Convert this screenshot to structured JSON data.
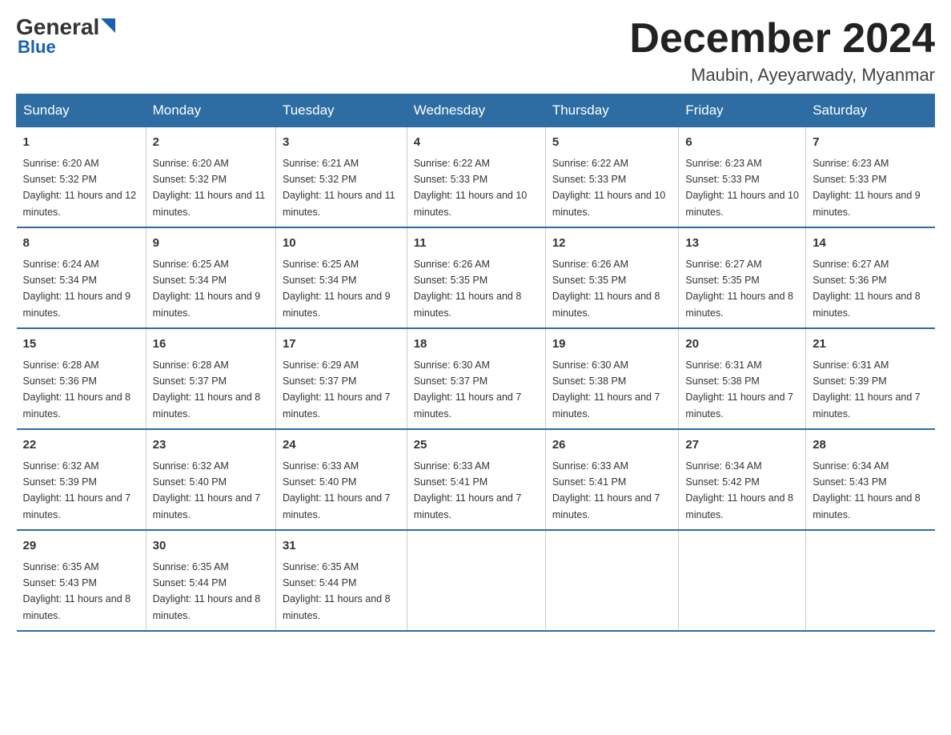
{
  "logo": {
    "general": "General",
    "blue": "Blue"
  },
  "header": {
    "month_title": "December 2024",
    "location": "Maubin, Ayeyarwady, Myanmar"
  },
  "days_of_week": [
    "Sunday",
    "Monday",
    "Tuesday",
    "Wednesday",
    "Thursday",
    "Friday",
    "Saturday"
  ],
  "weeks": [
    [
      {
        "day": "1",
        "sunrise": "Sunrise: 6:20 AM",
        "sunset": "Sunset: 5:32 PM",
        "daylight": "Daylight: 11 hours and 12 minutes."
      },
      {
        "day": "2",
        "sunrise": "Sunrise: 6:20 AM",
        "sunset": "Sunset: 5:32 PM",
        "daylight": "Daylight: 11 hours and 11 minutes."
      },
      {
        "day": "3",
        "sunrise": "Sunrise: 6:21 AM",
        "sunset": "Sunset: 5:32 PM",
        "daylight": "Daylight: 11 hours and 11 minutes."
      },
      {
        "day": "4",
        "sunrise": "Sunrise: 6:22 AM",
        "sunset": "Sunset: 5:33 PM",
        "daylight": "Daylight: 11 hours and 10 minutes."
      },
      {
        "day": "5",
        "sunrise": "Sunrise: 6:22 AM",
        "sunset": "Sunset: 5:33 PM",
        "daylight": "Daylight: 11 hours and 10 minutes."
      },
      {
        "day": "6",
        "sunrise": "Sunrise: 6:23 AM",
        "sunset": "Sunset: 5:33 PM",
        "daylight": "Daylight: 11 hours and 10 minutes."
      },
      {
        "day": "7",
        "sunrise": "Sunrise: 6:23 AM",
        "sunset": "Sunset: 5:33 PM",
        "daylight": "Daylight: 11 hours and 9 minutes."
      }
    ],
    [
      {
        "day": "8",
        "sunrise": "Sunrise: 6:24 AM",
        "sunset": "Sunset: 5:34 PM",
        "daylight": "Daylight: 11 hours and 9 minutes."
      },
      {
        "day": "9",
        "sunrise": "Sunrise: 6:25 AM",
        "sunset": "Sunset: 5:34 PM",
        "daylight": "Daylight: 11 hours and 9 minutes."
      },
      {
        "day": "10",
        "sunrise": "Sunrise: 6:25 AM",
        "sunset": "Sunset: 5:34 PM",
        "daylight": "Daylight: 11 hours and 9 minutes."
      },
      {
        "day": "11",
        "sunrise": "Sunrise: 6:26 AM",
        "sunset": "Sunset: 5:35 PM",
        "daylight": "Daylight: 11 hours and 8 minutes."
      },
      {
        "day": "12",
        "sunrise": "Sunrise: 6:26 AM",
        "sunset": "Sunset: 5:35 PM",
        "daylight": "Daylight: 11 hours and 8 minutes."
      },
      {
        "day": "13",
        "sunrise": "Sunrise: 6:27 AM",
        "sunset": "Sunset: 5:35 PM",
        "daylight": "Daylight: 11 hours and 8 minutes."
      },
      {
        "day": "14",
        "sunrise": "Sunrise: 6:27 AM",
        "sunset": "Sunset: 5:36 PM",
        "daylight": "Daylight: 11 hours and 8 minutes."
      }
    ],
    [
      {
        "day": "15",
        "sunrise": "Sunrise: 6:28 AM",
        "sunset": "Sunset: 5:36 PM",
        "daylight": "Daylight: 11 hours and 8 minutes."
      },
      {
        "day": "16",
        "sunrise": "Sunrise: 6:28 AM",
        "sunset": "Sunset: 5:37 PM",
        "daylight": "Daylight: 11 hours and 8 minutes."
      },
      {
        "day": "17",
        "sunrise": "Sunrise: 6:29 AM",
        "sunset": "Sunset: 5:37 PM",
        "daylight": "Daylight: 11 hours and 7 minutes."
      },
      {
        "day": "18",
        "sunrise": "Sunrise: 6:30 AM",
        "sunset": "Sunset: 5:37 PM",
        "daylight": "Daylight: 11 hours and 7 minutes."
      },
      {
        "day": "19",
        "sunrise": "Sunrise: 6:30 AM",
        "sunset": "Sunset: 5:38 PM",
        "daylight": "Daylight: 11 hours and 7 minutes."
      },
      {
        "day": "20",
        "sunrise": "Sunrise: 6:31 AM",
        "sunset": "Sunset: 5:38 PM",
        "daylight": "Daylight: 11 hours and 7 minutes."
      },
      {
        "day": "21",
        "sunrise": "Sunrise: 6:31 AM",
        "sunset": "Sunset: 5:39 PM",
        "daylight": "Daylight: 11 hours and 7 minutes."
      }
    ],
    [
      {
        "day": "22",
        "sunrise": "Sunrise: 6:32 AM",
        "sunset": "Sunset: 5:39 PM",
        "daylight": "Daylight: 11 hours and 7 minutes."
      },
      {
        "day": "23",
        "sunrise": "Sunrise: 6:32 AM",
        "sunset": "Sunset: 5:40 PM",
        "daylight": "Daylight: 11 hours and 7 minutes."
      },
      {
        "day": "24",
        "sunrise": "Sunrise: 6:33 AM",
        "sunset": "Sunset: 5:40 PM",
        "daylight": "Daylight: 11 hours and 7 minutes."
      },
      {
        "day": "25",
        "sunrise": "Sunrise: 6:33 AM",
        "sunset": "Sunset: 5:41 PM",
        "daylight": "Daylight: 11 hours and 7 minutes."
      },
      {
        "day": "26",
        "sunrise": "Sunrise: 6:33 AM",
        "sunset": "Sunset: 5:41 PM",
        "daylight": "Daylight: 11 hours and 7 minutes."
      },
      {
        "day": "27",
        "sunrise": "Sunrise: 6:34 AM",
        "sunset": "Sunset: 5:42 PM",
        "daylight": "Daylight: 11 hours and 8 minutes."
      },
      {
        "day": "28",
        "sunrise": "Sunrise: 6:34 AM",
        "sunset": "Sunset: 5:43 PM",
        "daylight": "Daylight: 11 hours and 8 minutes."
      }
    ],
    [
      {
        "day": "29",
        "sunrise": "Sunrise: 6:35 AM",
        "sunset": "Sunset: 5:43 PM",
        "daylight": "Daylight: 11 hours and 8 minutes."
      },
      {
        "day": "30",
        "sunrise": "Sunrise: 6:35 AM",
        "sunset": "Sunset: 5:44 PM",
        "daylight": "Daylight: 11 hours and 8 minutes."
      },
      {
        "day": "31",
        "sunrise": "Sunrise: 6:35 AM",
        "sunset": "Sunset: 5:44 PM",
        "daylight": "Daylight: 11 hours and 8 minutes."
      },
      null,
      null,
      null,
      null
    ]
  ]
}
